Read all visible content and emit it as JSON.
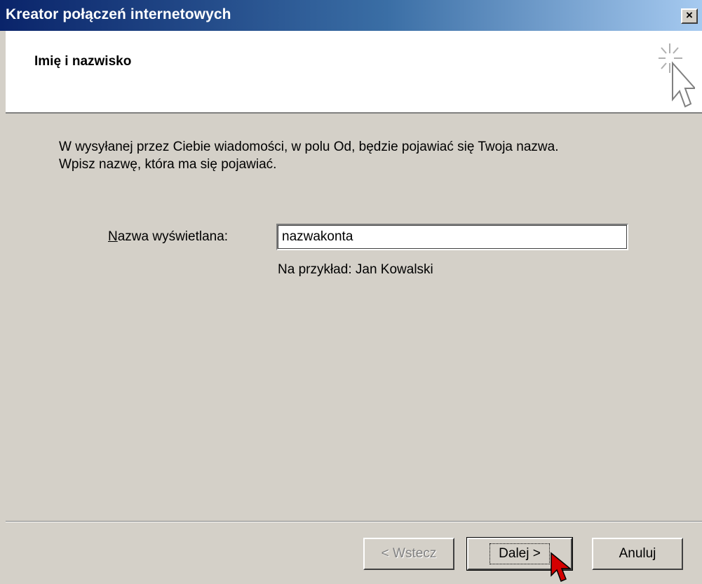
{
  "window": {
    "title": "Kreator połączeń internetowych",
    "close_label": "×"
  },
  "header": {
    "title": "Imię i nazwisko",
    "icon": "wizard-sparkle-cursor-icon"
  },
  "body": {
    "intro_line1": "W wysyłanej przez Ciebie wiadomości, w polu Od, będzie pojawiać się Twoja nazwa.",
    "intro_line2": "Wpisz nazwę, która ma się pojawiać.",
    "field_label_hotkey": "N",
    "field_label_rest": "azwa wyświetlana:",
    "field_value": "nazwakonta",
    "example": "Na przykład: Jan Kowalski"
  },
  "buttons": {
    "back": "< Wstecz",
    "next": "Dalej >",
    "cancel": "Anuluj"
  },
  "colors": {
    "title_start": "#0a246a",
    "title_end": "#a6caf0",
    "face": "#d4d0c8",
    "cursor": "#d40000"
  }
}
